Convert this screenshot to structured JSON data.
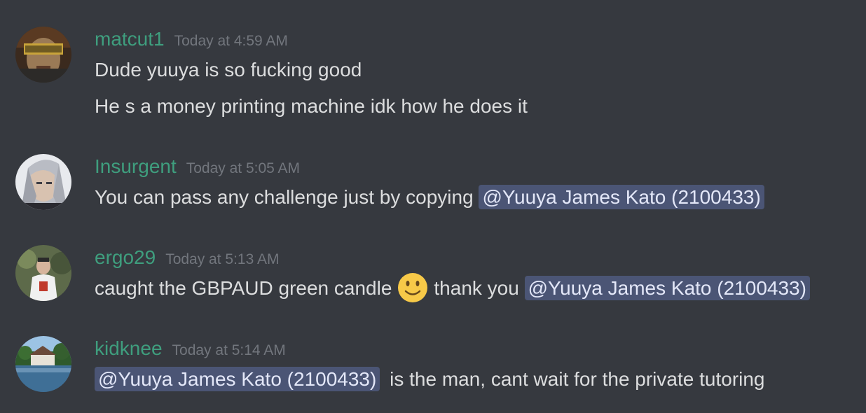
{
  "messages": [
    {
      "username": "matcut1",
      "timestamp": "Today at 4:59 AM",
      "lines": [
        "Dude yuuya is so fucking good",
        "He s a money printing machine idk how he does it"
      ]
    },
    {
      "username": "Insurgent",
      "timestamp": "Today at 5:05 AM",
      "text_before": "You can pass any challenge just by copying",
      "mention": "@Yuuya James Kato (2100433)"
    },
    {
      "username": "ergo29",
      "timestamp": "Today at 5:13 AM",
      "text_before": "caught the GBPAUD green candle",
      "emoji": "slightly-smiling-face",
      "text_after": "thank you",
      "mention": "@Yuuya James Kato (2100433)"
    },
    {
      "username": "kidknee",
      "timestamp": "Today at 5:14 AM",
      "mention": "@Yuuya James Kato (2100433)",
      "text_after": "is the man, cant wait for the private tutoring"
    }
  ],
  "colors": {
    "background": "#36393f",
    "username": "#3f9e7e",
    "timestamp": "#72767d",
    "text": "#dcddde",
    "mention_bg": "#4a4f85"
  }
}
